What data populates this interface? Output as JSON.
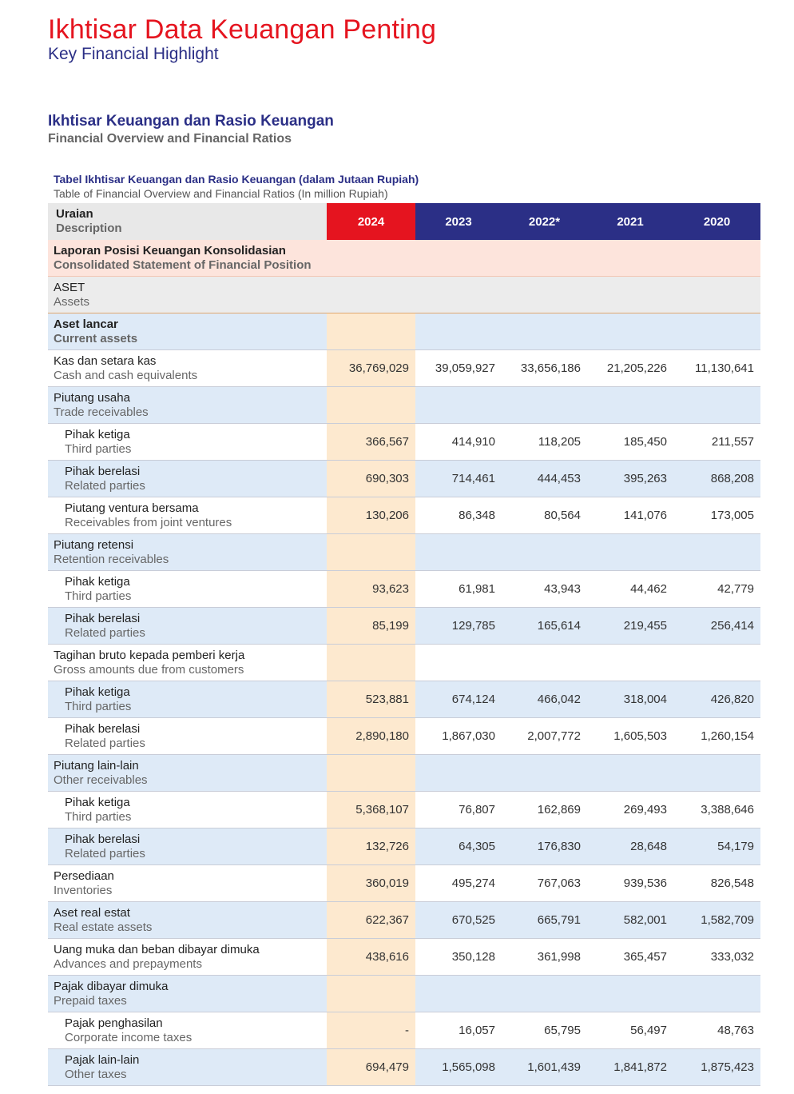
{
  "header": {
    "title": "Ikhtisar Data Keuangan Penting",
    "subtitle": "Key Financial Highlight"
  },
  "section": {
    "title": "Ikhtisar Keuangan dan Rasio Keuangan",
    "subtitle": "Financial Overview and Financial Ratios"
  },
  "table": {
    "caption": "Tabel Ikhtisar Keuangan dan Rasio Keuangan (dalam Jutaan Rupiah)",
    "caption_en": "Table of Financial Overview and Financial Ratios (In million Rupiah)",
    "desc_header": "Uraian",
    "desc_header_en": "Description",
    "years": [
      "2024",
      "2023",
      "2022*",
      "2021",
      "2020"
    ],
    "colors": {
      "accent_red": "#e5141f",
      "navy": "#2b2f86",
      "highlight_2024": "#fde9cf",
      "row_blue": "#deeaf7"
    },
    "rows": [
      {
        "id": "Laporan Posisi Keuangan Konsolidasian",
        "en": "Consolidated Statement of Financial Position",
        "style": "pink",
        "bold": true,
        "indent": false,
        "values": []
      },
      {
        "id": "ASET",
        "en": "Assets",
        "style": "grey",
        "bold": false,
        "indent": false,
        "values": []
      },
      {
        "id": "Aset lancar",
        "en": "Current assets",
        "style": "blue",
        "bold": true,
        "indent": false,
        "values": []
      },
      {
        "id": "Kas dan setara kas",
        "en": "Cash and cash equivalents",
        "style": "white",
        "bold": false,
        "indent": false,
        "values": [
          "36,769,029",
          "39,059,927",
          "33,656,186",
          "21,205,226",
          "11,130,641"
        ]
      },
      {
        "id": "Piutang usaha",
        "en": "Trade receivables",
        "style": "blue",
        "bold": false,
        "indent": false,
        "values": []
      },
      {
        "id": "Pihak ketiga",
        "en": "Third parties",
        "style": "white",
        "bold": false,
        "indent": true,
        "values": [
          "366,567",
          "414,910",
          "118,205",
          "185,450",
          "211,557"
        ]
      },
      {
        "id": "Pihak berelasi",
        "en": "Related parties",
        "style": "blue",
        "bold": false,
        "indent": true,
        "values": [
          "690,303",
          "714,461",
          "444,453",
          "395,263",
          "868,208"
        ]
      },
      {
        "id": "Piutang ventura bersama",
        "en": "Receivables from joint ventures",
        "style": "white",
        "bold": false,
        "indent": true,
        "values": [
          "130,206",
          "86,348",
          "80,564",
          "141,076",
          "173,005"
        ]
      },
      {
        "id": "Piutang retensi",
        "en": "Retention receivables",
        "style": "blue",
        "bold": false,
        "indent": false,
        "values": []
      },
      {
        "id": "Pihak ketiga",
        "en": "Third parties",
        "style": "white",
        "bold": false,
        "indent": true,
        "values": [
          "93,623",
          "61,981",
          "43,943",
          "44,462",
          "42,779"
        ]
      },
      {
        "id": "Pihak berelasi",
        "en": "Related parties",
        "style": "blue",
        "bold": false,
        "indent": true,
        "values": [
          "85,199",
          "129,785",
          "165,614",
          "219,455",
          "256,414"
        ]
      },
      {
        "id": "Tagihan bruto kepada pemberi kerja",
        "en": "Gross amounts due from customers",
        "style": "white",
        "bold": false,
        "indent": false,
        "values": []
      },
      {
        "id": "Pihak ketiga",
        "en": "Third parties",
        "style": "blue",
        "bold": false,
        "indent": true,
        "values": [
          "523,881",
          "674,124",
          "466,042",
          "318,004",
          "426,820"
        ]
      },
      {
        "id": "Pihak berelasi",
        "en": "Related parties",
        "style": "white",
        "bold": false,
        "indent": true,
        "values": [
          "2,890,180",
          "1,867,030",
          "2,007,772",
          "1,605,503",
          "1,260,154"
        ]
      },
      {
        "id": "Piutang lain-lain",
        "en": "Other receivables",
        "style": "blue",
        "bold": false,
        "indent": false,
        "values": []
      },
      {
        "id": "Pihak ketiga",
        "en": "Third parties",
        "style": "white",
        "bold": false,
        "indent": true,
        "values": [
          "5,368,107",
          "76,807",
          "162,869",
          "269,493",
          "3,388,646"
        ]
      },
      {
        "id": "Pihak berelasi",
        "en": "Related parties",
        "style": "blue",
        "bold": false,
        "indent": true,
        "values": [
          "132,726",
          "64,305",
          "176,830",
          "28,648",
          "54,179"
        ]
      },
      {
        "id": "Persediaan",
        "en": "Inventories",
        "style": "white",
        "bold": false,
        "indent": false,
        "values": [
          "360,019",
          "495,274",
          "767,063",
          "939,536",
          "826,548"
        ]
      },
      {
        "id": "Aset real estat",
        "en": "Real estate assets",
        "style": "blue",
        "bold": false,
        "indent": false,
        "values": [
          "622,367",
          "670,525",
          "665,791",
          "582,001",
          "1,582,709"
        ]
      },
      {
        "id": "Uang muka dan beban dibayar dimuka",
        "en": "Advances and prepayments",
        "style": "white",
        "bold": false,
        "indent": false,
        "values": [
          "438,616",
          "350,128",
          "361,998",
          "365,457",
          "333,032"
        ]
      },
      {
        "id": "Pajak dibayar dimuka",
        "en": "Prepaid taxes",
        "style": "blue",
        "bold": false,
        "indent": false,
        "values": []
      },
      {
        "id": "Pajak penghasilan",
        "en": "Corporate income taxes",
        "style": "white",
        "bold": false,
        "indent": true,
        "values": [
          "-",
          "16,057",
          "65,795",
          "56,497",
          "48,763"
        ]
      },
      {
        "id": "Pajak lain-lain",
        "en": "Other taxes",
        "style": "blue",
        "bold": false,
        "indent": true,
        "values": [
          "694,479",
          "1,565,098",
          "1,601,439",
          "1,841,872",
          "1,875,423"
        ]
      }
    ]
  }
}
